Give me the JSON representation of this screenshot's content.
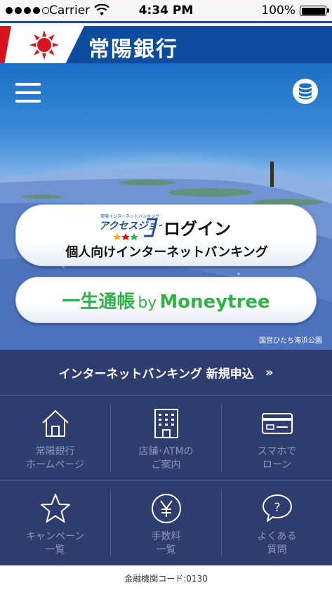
{
  "status_bar": {
    "carrier": "Carrier",
    "time": "4:34 PM",
    "battery": "100%"
  },
  "header": {
    "bank_name": "常陽銀行",
    "colors": {
      "band": "#0d4c9e",
      "red": "#d9141c"
    }
  },
  "hero": {
    "menu_icon": "hamburger-icon",
    "account_icon": "database-icon",
    "login": {
      "brand": "アクセスジョイ",
      "label": "ログイン",
      "subtitle": "個人向けインターネットバンキング"
    },
    "moneytree": {
      "prefix": "一生通帳",
      "by": "by",
      "brand": "Moneytree",
      "color": "#2fb348"
    },
    "photo_credit": "国営ひたち海浜公園"
  },
  "panel": {
    "apply_label": "インターネットバンキング 新規申込",
    "apply_chevron": "»",
    "items": [
      {
        "label": "常陽銀行\nホームページ",
        "icon": "home-icon"
      },
      {
        "label": "店舗･ATMの\nご案内",
        "icon": "building-icon"
      },
      {
        "label": "スマホで\nローン",
        "icon": "card-icon"
      },
      {
        "label": "キャンペーン\n一覧",
        "icon": "star-icon"
      },
      {
        "label": "手数料\n一覧",
        "icon": "yen-icon"
      },
      {
        "label": "よくある\n質問",
        "icon": "question-icon"
      }
    ],
    "colors": {
      "background": "#2f3d6e",
      "label": "#8c97bd"
    }
  },
  "footer": {
    "bank_code": "金融機関コード:0130"
  }
}
